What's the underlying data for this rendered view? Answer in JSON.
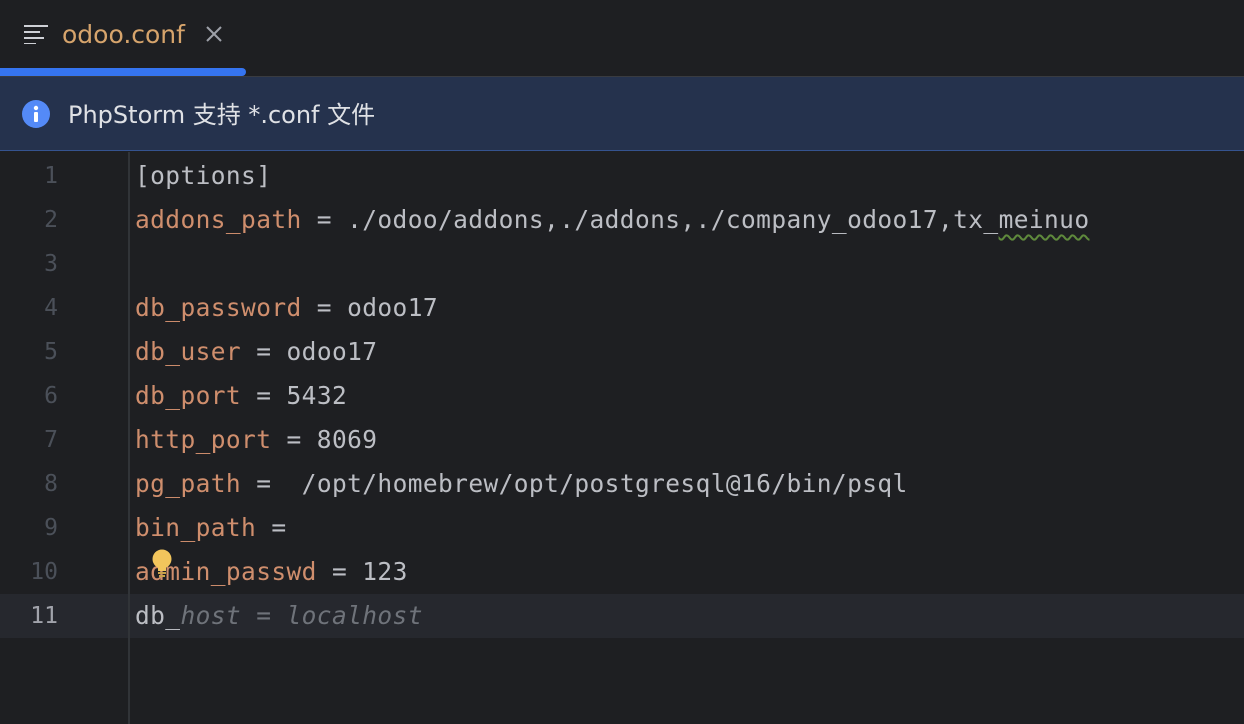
{
  "tab": {
    "icon": "structure-lines-icon",
    "title": "odoo.conf",
    "close_icon": "close-icon"
  },
  "banner": {
    "icon": "info-icon",
    "text": "PhpStorm 支持 *.conf 文件"
  },
  "editor": {
    "current_line": 11,
    "lines": [
      {
        "num": "1",
        "segments": [
          {
            "text": "[options]",
            "kind": "v"
          }
        ]
      },
      {
        "num": "2",
        "segments": [
          {
            "text": "addons_path",
            "kind": "k"
          },
          {
            "text": " = ./odoo/addons,./addons,./company_odoo17,tx_",
            "kind": "v"
          },
          {
            "text": "meinuo",
            "kind": "squiggle"
          }
        ]
      },
      {
        "num": "3",
        "segments": []
      },
      {
        "num": "4",
        "segments": [
          {
            "text": "db_password",
            "kind": "k"
          },
          {
            "text": " = odoo17",
            "kind": "v"
          }
        ]
      },
      {
        "num": "5",
        "segments": [
          {
            "text": "db_user",
            "kind": "k"
          },
          {
            "text": " = odoo17",
            "kind": "v"
          }
        ]
      },
      {
        "num": "6",
        "segments": [
          {
            "text": "db_port",
            "kind": "k"
          },
          {
            "text": " = 5432",
            "kind": "v"
          }
        ]
      },
      {
        "num": "7",
        "segments": [
          {
            "text": "http_port",
            "kind": "k"
          },
          {
            "text": " = 8069",
            "kind": "v"
          }
        ]
      },
      {
        "num": "8",
        "segments": [
          {
            "text": "pg_path",
            "kind": "k"
          },
          {
            "text": " =  /opt/homebrew/opt/postgresql@16/bin/psql",
            "kind": "v"
          }
        ]
      },
      {
        "num": "9",
        "segments": [
          {
            "text": "bin_path",
            "kind": "k"
          },
          {
            "text": " =",
            "kind": "v"
          }
        ]
      },
      {
        "num": "10",
        "segments": [
          {
            "text": "admin_passwd",
            "kind": "k"
          },
          {
            "text": " = 123",
            "kind": "v"
          }
        ]
      },
      {
        "num": "11",
        "segments": [
          {
            "text": "db_",
            "kind": "v"
          },
          {
            "text": "host = localhost",
            "kind": "ghost"
          }
        ]
      }
    ],
    "intention_icon": "lightbulb-icon"
  },
  "colors": {
    "accent": "#3574f0",
    "key": "#cf8e6d",
    "text": "#bcbec4",
    "tab_title": "#d6a46c",
    "banner_bg": "#25324d"
  }
}
